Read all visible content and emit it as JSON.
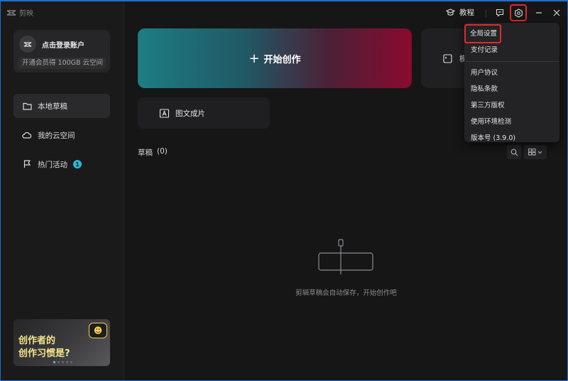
{
  "app": {
    "logo_text": "剪映"
  },
  "account": {
    "login_text": "点击登录账户",
    "member_hint": "开通会员得 100GB 云空间"
  },
  "sidebar": {
    "items": [
      {
        "label": "本地草稿",
        "icon": "folder-icon"
      },
      {
        "label": "我的云空间",
        "icon": "cloud-icon"
      },
      {
        "label": "热门活动",
        "icon": "flag-icon",
        "badge": "1"
      }
    ]
  },
  "promo": {
    "line1": "创作者的",
    "line2": "创作习惯是?"
  },
  "topbar": {
    "tutorial_label": "教程"
  },
  "main": {
    "create_label": "开始创作",
    "second_label": "模",
    "image_text_label": "图文成片",
    "drafts_label": "草稿",
    "drafts_count": "(0)",
    "empty_hint": "剪辑草稿会自动保存，开始创作吧"
  },
  "menu": {
    "items": [
      {
        "label": "全局设置"
      },
      {
        "label": "支付记录"
      },
      {
        "label": "用户协议"
      },
      {
        "label": "隐私条款"
      },
      {
        "label": "第三方版权"
      },
      {
        "label": "使用环境检测"
      },
      {
        "label": "版本号 (3.9.0)"
      }
    ]
  },
  "colors": {
    "accent_gradient_start": "#1e7d83",
    "accent_gradient_end": "#8a0a30",
    "badge": "#2bb6d8",
    "highlight": "#e02a2a"
  }
}
